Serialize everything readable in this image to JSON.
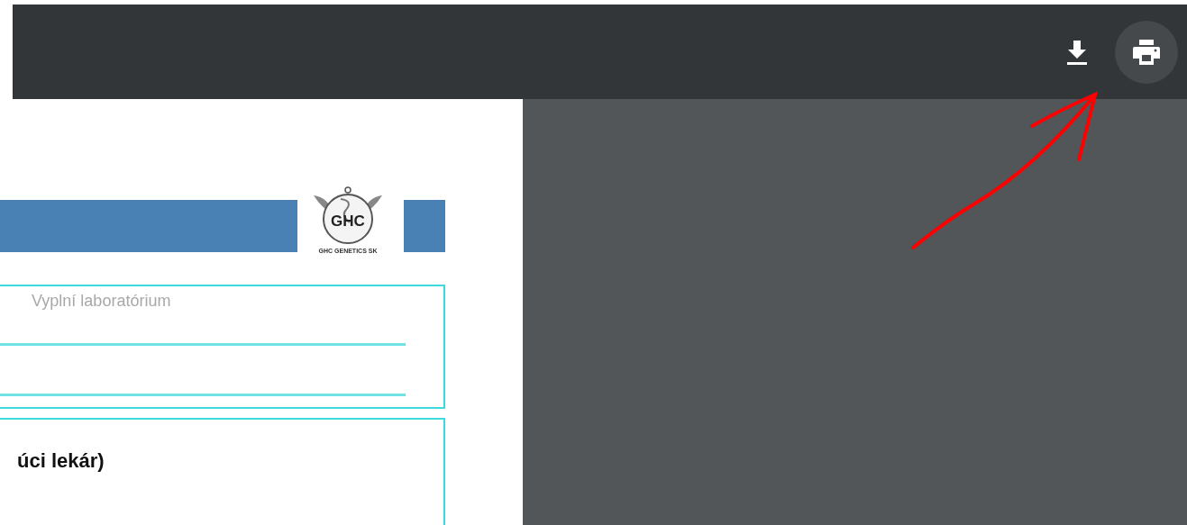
{
  "toolbar": {
    "buttons": [
      {
        "kind": "download",
        "highlighted": false
      },
      {
        "kind": "print",
        "highlighted": true
      }
    ]
  },
  "document": {
    "logo": {
      "initials": "GHC",
      "caption": "GHC GENETICS SK"
    },
    "lab_section": {
      "label": "Vyplní laboratórium"
    },
    "doctor_section": {
      "heading": "úci lekár)"
    }
  },
  "annotation": {
    "kind": "arrow",
    "color": "#ff0000"
  }
}
